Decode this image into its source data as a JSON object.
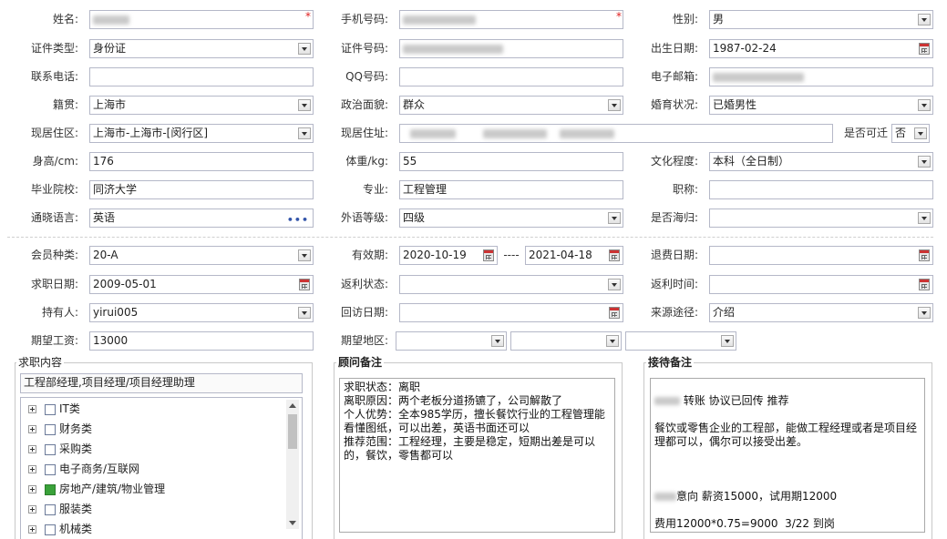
{
  "row1": {
    "name_label": "姓名:",
    "name_value": "",
    "phone_label": "手机号码:",
    "phone_value": "",
    "gender_label": "性别:",
    "gender_value": "男",
    "required_mark": "*"
  },
  "row2": {
    "idtype_label": "证件类型:",
    "idtype_value": "身份证",
    "idno_label": "证件号码:",
    "idno_value": "",
    "birth_label": "出生日期:",
    "birth_value": "1987-02-24"
  },
  "row3": {
    "tel_label": "联系电话:",
    "tel_value": "",
    "qq_label": "QQ号码:",
    "qq_value": "",
    "email_label": "电子邮箱:",
    "email_value": ""
  },
  "row4": {
    "native_label": "籍贯:",
    "native_value": "上海市",
    "political_label": "政治面貌:",
    "political_value": "群众",
    "marital_label": "婚育状况:",
    "marital_value": "已婚男性"
  },
  "row5": {
    "area_label": "现居住区:",
    "area_value": "上海市-上海市-[闵行区]",
    "address_label": "现居住址:",
    "address_value": "",
    "relocate_label": "是否可迁",
    "relocate_value": "否"
  },
  "row6": {
    "height_label": "身高/cm:",
    "height_value": "176",
    "weight_label": "体重/kg:",
    "weight_value": "55",
    "education_label": "文化程度:",
    "education_value": "本科（全日制）"
  },
  "row7": {
    "school_label": "毕业院校:",
    "school_value": "同济大学",
    "major_label": "专业:",
    "major_value": "工程管理",
    "title_label": "职称:",
    "title_value": ""
  },
  "row8": {
    "language_label": "通晓语言:",
    "language_value": "英语",
    "language_more": "•••",
    "foreign_level_label": "外语等级:",
    "foreign_level_value": "四级",
    "overseas_label": "是否海归:",
    "overseas_value": ""
  },
  "row9": {
    "member_type_label": "会员种类:",
    "member_type_value": "20-A",
    "valid_label": "有效期:",
    "valid_from": "2020-10-19",
    "valid_sep": "----",
    "valid_to": "2021-04-18",
    "refund_date_label": "退费日期:",
    "refund_date_value": ""
  },
  "row10": {
    "jobseek_date_label": "求职日期:",
    "jobseek_date_value": "2009-05-01",
    "rebate_status_label": "返利状态:",
    "rebate_status_value": "",
    "rebate_time_label": "返利时间:",
    "rebate_time_value": ""
  },
  "row11": {
    "holder_label": "持有人:",
    "holder_value": "yirui005",
    "revisit_label": "回访日期:",
    "revisit_value": "",
    "source_label": "来源途径:",
    "source_value": "介绍"
  },
  "row12": {
    "salary_label": "期望工资:",
    "salary_value": "13000",
    "region_label": "期望地区:",
    "region_1": "",
    "region_2": "",
    "region_3": ""
  },
  "jobs": {
    "title": "求职内容",
    "selected_text": "工程部经理,项目经理/项目经理助理",
    "items": [
      {
        "label": "IT类",
        "checked": false
      },
      {
        "label": "财务类",
        "checked": false
      },
      {
        "label": "采购类",
        "checked": false
      },
      {
        "label": "电子商务/互联网",
        "checked": false
      },
      {
        "label": "房地产/建筑/物业管理",
        "checked": true
      },
      {
        "label": "服装类",
        "checked": false
      },
      {
        "label": "机械类",
        "checked": false
      }
    ]
  },
  "advisor": {
    "title": "顾问备注",
    "text": "求职状态：离职\n离职原因：两个老板分道扬镳了，公司解散了\n个人优势：全本985学历，擅长餐饮行业的工程管理能看懂图纸，可以出差，英语书面还可以\n推荐范围：工程经理，主要是稳定，短期出差是可以的，餐饮，零售都可以"
  },
  "reception": {
    "title": "接待备注",
    "line1": " 转账 协议已回传 推荐",
    "line2": "餐饮或零售企业的工程部，能做工程经理或者是项目经理都可以，偶尔可以接受出差。",
    "line3": "意向 薪资15000，试用期12000",
    "line4": "费用12000*0.75=9000  3/22 到岗"
  },
  "colors": {
    "border": "#b5b8c8",
    "required": "#e02020",
    "checked": "#3aa23a"
  }
}
